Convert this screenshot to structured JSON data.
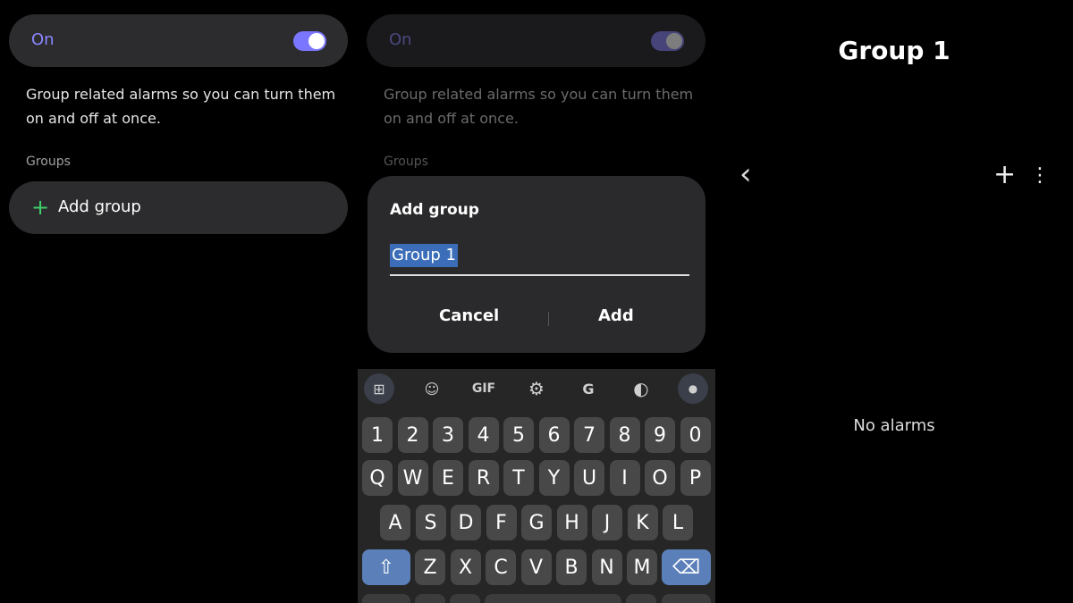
{
  "settings": {
    "toggle_label": "On",
    "description": "Group related alarms so you can turn them on and off at once.",
    "section_title": "Groups",
    "add_group_label": "Add group",
    "plus_glyph": "+"
  },
  "dialog": {
    "title": "Add group",
    "input_value": "Group 1",
    "cancel_label": "Cancel",
    "add_label": "Add"
  },
  "keyboard": {
    "toolbar": {
      "apps_icon": "⊞",
      "sticker_icon": "☺",
      "gif_label": "GIF",
      "settings_icon": "⚙",
      "translate_icon": "G",
      "palette_icon": "◐",
      "mic_icon": "●"
    },
    "row_numbers": [
      "1",
      "2",
      "3",
      "4",
      "5",
      "6",
      "7",
      "8",
      "9",
      "0"
    ],
    "row_q": [
      "Q",
      "W",
      "E",
      "R",
      "T",
      "Y",
      "U",
      "I",
      "O",
      "P"
    ],
    "row_a": [
      "A",
      "S",
      "D",
      "F",
      "G",
      "H",
      "J",
      "K",
      "L"
    ],
    "row_z": [
      "Z",
      "X",
      "C",
      "V",
      "B",
      "N",
      "M"
    ],
    "shift_glyph": "⇧",
    "backspace_glyph": "⌫"
  },
  "group_screen": {
    "title": "Group 1",
    "back_glyph": "‹",
    "add_glyph": "+",
    "more_glyph": "⋮",
    "empty_text": "No alarms"
  },
  "colors": {
    "accent_purple": "#7a76ff",
    "plus_green": "#3fcf6a",
    "selection_blue": "#3b6db8"
  }
}
